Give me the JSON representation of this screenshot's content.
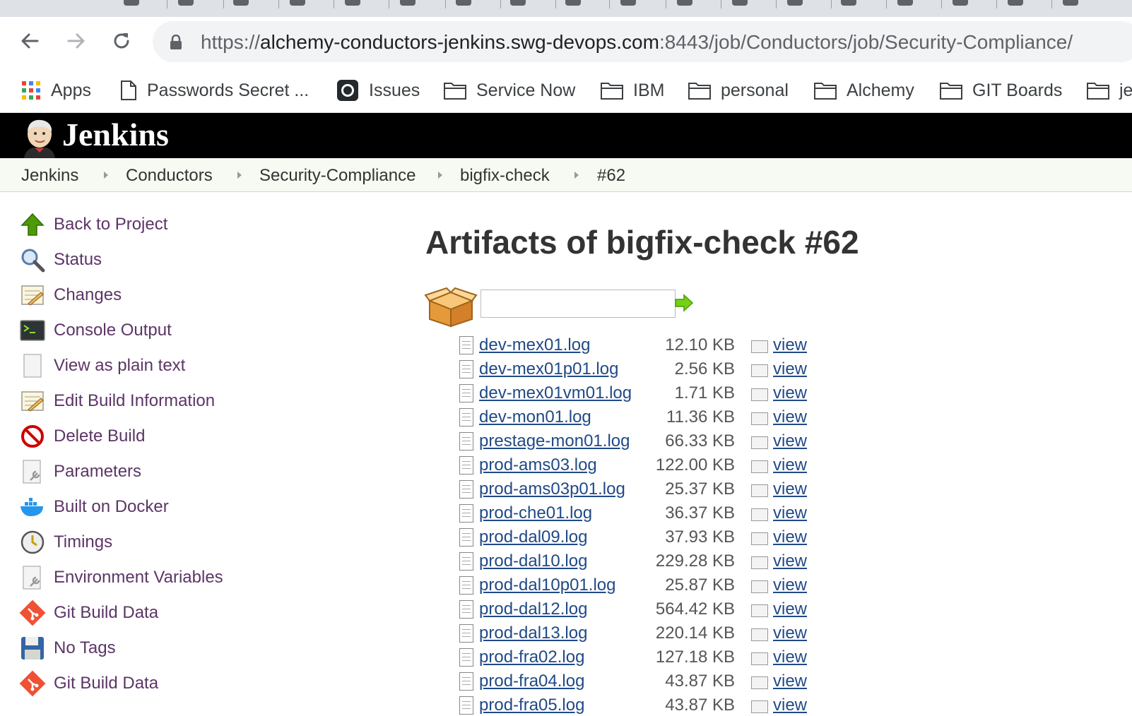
{
  "browser": {
    "url_scheme": "https://",
    "url_host": "alchemy-conductors-jenkins.swg-devops.com",
    "url_path": ":8443/job/Conductors/job/Security-Compliance/",
    "bookmarks": [
      {
        "label": "Apps",
        "icon": "apps-grid-icon"
      },
      {
        "label": "Passwords Secret ...",
        "icon": "page-icon"
      },
      {
        "label": "Issues",
        "icon": "github-icon"
      },
      {
        "label": "Service Now",
        "icon": "folder-icon"
      },
      {
        "label": "IBM",
        "icon": "folder-icon"
      },
      {
        "label": "personal",
        "icon": "folder-icon"
      },
      {
        "label": "Alchemy",
        "icon": "folder-icon"
      },
      {
        "label": "GIT Boards",
        "icon": "folder-icon"
      },
      {
        "label": "je",
        "icon": "folder-icon"
      }
    ]
  },
  "jenkins": {
    "title": "Jenkins",
    "breadcrumbs": [
      "Jenkins",
      "Conductors",
      "Security-Compliance",
      "bigfix-check",
      "#62"
    ]
  },
  "side_panel": {
    "tasks": [
      {
        "label": "Back to Project",
        "icon": "up-arrow-icon"
      },
      {
        "label": "Status",
        "icon": "magnifier-icon"
      },
      {
        "label": "Changes",
        "icon": "notepad-icon"
      },
      {
        "label": "Console Output",
        "icon": "terminal-icon"
      },
      {
        "label": "View as plain text",
        "icon": "document-icon"
      },
      {
        "label": "Edit Build Information",
        "icon": "notepad-icon"
      },
      {
        "label": "Delete Build",
        "icon": "no-entry-icon"
      },
      {
        "label": "Parameters",
        "icon": "document-wrench-icon"
      },
      {
        "label": "Built on Docker",
        "icon": "docker-icon"
      },
      {
        "label": "Timings",
        "icon": "clock-icon"
      },
      {
        "label": "Environment Variables",
        "icon": "document-wrench-icon"
      },
      {
        "label": "Git Build Data",
        "icon": "git-icon"
      },
      {
        "label": "No Tags",
        "icon": "floppy-icon"
      },
      {
        "label": "Git Build Data",
        "icon": "git-icon"
      }
    ]
  },
  "main": {
    "title": "Artifacts of bigfix-check #62",
    "search_value": "",
    "view_label": "view",
    "artifacts": [
      {
        "name": "dev-mex01.log",
        "size": "12.10 KB"
      },
      {
        "name": "dev-mex01p01.log",
        "size": "2.56 KB"
      },
      {
        "name": "dev-mex01vm01.log",
        "size": "1.71 KB"
      },
      {
        "name": "dev-mon01.log",
        "size": "11.36 KB"
      },
      {
        "name": "prestage-mon01.log",
        "size": "66.33 KB"
      },
      {
        "name": "prod-ams03.log",
        "size": "122.00 KB"
      },
      {
        "name": "prod-ams03p01.log",
        "size": "25.37 KB"
      },
      {
        "name": "prod-che01.log",
        "size": "36.37 KB"
      },
      {
        "name": "prod-dal09.log",
        "size": "37.93 KB"
      },
      {
        "name": "prod-dal10.log",
        "size": "229.28 KB"
      },
      {
        "name": "prod-dal10p01.log",
        "size": "25.87 KB"
      },
      {
        "name": "prod-dal12.log",
        "size": "564.42 KB"
      },
      {
        "name": "prod-dal13.log",
        "size": "220.14 KB"
      },
      {
        "name": "prod-fra02.log",
        "size": "127.18 KB"
      },
      {
        "name": "prod-fra04.log",
        "size": "43.87 KB"
      },
      {
        "name": "prod-fra05.log",
        "size": "43.87 KB"
      }
    ]
  }
}
